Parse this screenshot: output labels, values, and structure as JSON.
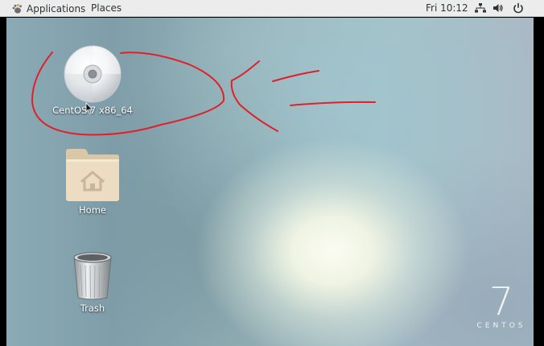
{
  "topbar": {
    "applications_label": "Applications",
    "places_label": "Places",
    "clock": "Fri 10:12"
  },
  "desktop": {
    "icons": [
      {
        "label": "CentOS 7 x86_64",
        "icon": "disc-icon"
      },
      {
        "label": "Home",
        "icon": "home-folder-icon"
      },
      {
        "label": "Trash",
        "icon": "trash-icon"
      }
    ],
    "brand": {
      "number": "7",
      "word": "CENTOS"
    }
  },
  "colors": {
    "topbar_bg": "#ececec",
    "annotation_red": "#e0202a"
  }
}
